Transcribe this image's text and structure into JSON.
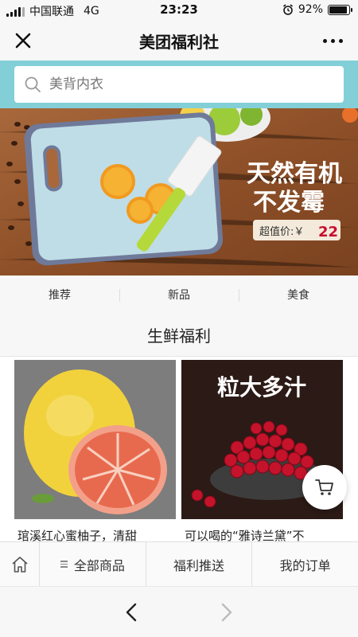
{
  "status_bar": {
    "carrier": "中国联通",
    "network": "4G",
    "time": "23:23",
    "battery": "92%",
    "battery_level": 0.92
  },
  "nav": {
    "title": "美团福利社",
    "close_icon": "close-icon",
    "more_icon": "more-icon"
  },
  "search": {
    "placeholder": "美背内衣"
  },
  "banner": {
    "headline_1": "天然有机",
    "headline_2": "不发霉",
    "price_label": "超值价:￥",
    "price": "22"
  },
  "tabs": [
    {
      "label": "推荐"
    },
    {
      "label": "新品"
    },
    {
      "label": "美食"
    }
  ],
  "section": {
    "title": "生鲜福利"
  },
  "products": [
    {
      "name": "琯溪红心蜜柚子，清甜"
    },
    {
      "name": "可以喝的“雅诗兰黛”不",
      "overlay_text": "粒大多汁"
    }
  ],
  "bottom_nav": {
    "home_icon": "home-icon",
    "all_products": "全部商品",
    "welfare_push": "福利推送",
    "my_orders": "我的订单"
  },
  "browser": {
    "back_icon": "back-icon",
    "forward_icon": "forward-icon"
  },
  "colors": {
    "search_bg": "#83cfd8",
    "banner_wood": "#9b5a32",
    "board": "#bfdde6",
    "knife_handle": "#b5d93a"
  }
}
